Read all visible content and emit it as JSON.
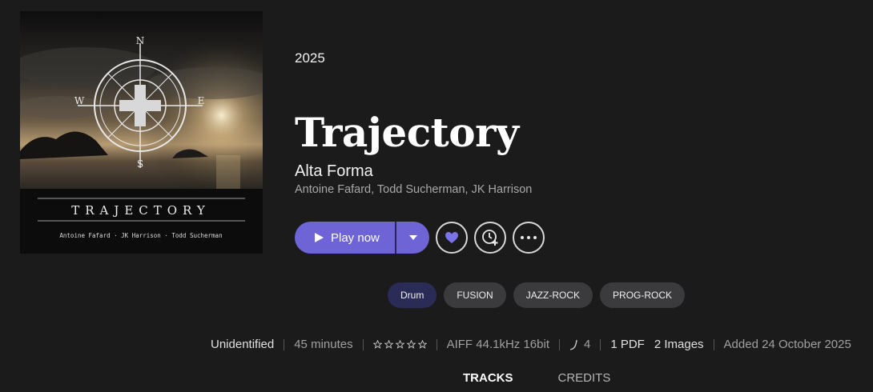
{
  "album": {
    "year": "2025",
    "title": "Trajectory",
    "artist": "Alta Forma",
    "performers": "Antoine Fafard, Todd Sucherman, JK Harrison"
  },
  "cover": {
    "title_text": "TRAJECTORY",
    "credits_text": "Antoine Fafard · JK Harrison · Todd Sucherman",
    "compass": [
      "N",
      "E",
      "S",
      "W"
    ]
  },
  "actions": {
    "play_label": "Play now",
    "accent": "#6e64d6"
  },
  "tags": [
    {
      "label": "Drum",
      "active": true
    },
    {
      "label": "FUSION",
      "active": false
    },
    {
      "label": "JAZZ-ROCK",
      "active": false
    },
    {
      "label": "PROG-ROCK",
      "active": false
    }
  ],
  "meta": {
    "status": "Unidentified",
    "duration": "45 minutes",
    "rating": 0,
    "format": "AIFF 44.1kHz 16bit",
    "bpm_value": "4",
    "pdf": "1 PDF",
    "images": "2 Images",
    "added": "Added 24 October 2025"
  },
  "tabs": [
    {
      "label": "TRACKS",
      "active": true
    },
    {
      "label": "CREDITS",
      "active": false
    }
  ]
}
